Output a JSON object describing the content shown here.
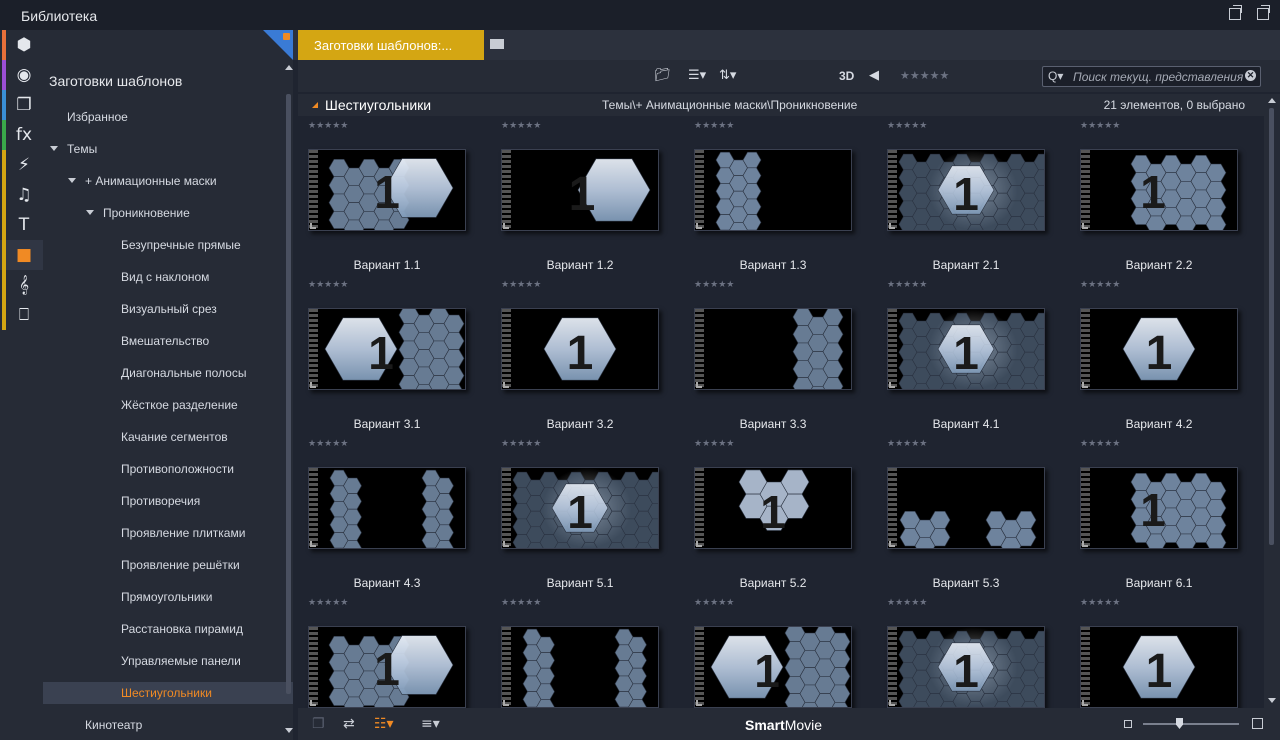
{
  "window": {
    "title": "Библиотека"
  },
  "sidebar_icons": [
    {
      "name": "media-icon",
      "glyph": "⬢",
      "color": "#e8703a"
    },
    {
      "name": "reel-icon",
      "glyph": "◉",
      "color": "#9b4fd6"
    },
    {
      "name": "pages-icon",
      "glyph": "❐",
      "color": "#3a8fd6"
    },
    {
      "name": "fx-icon",
      "glyph": "fx",
      "color": "#3aa84a"
    },
    {
      "name": "lightning-icon",
      "glyph": "⚡",
      "color": "#d4a613"
    },
    {
      "name": "music-icon",
      "glyph": "♫",
      "color": "#d4a613"
    },
    {
      "name": "title-icon",
      "glyph": "T",
      "color": "#d4a613"
    },
    {
      "name": "montage-icon",
      "glyph": "■",
      "color": "#d4a613"
    },
    {
      "name": "clef-icon",
      "glyph": "𝄞",
      "color": "#d4a613"
    },
    {
      "name": "piano-icon",
      "glyph": "⎕",
      "color": "#d4a613"
    }
  ],
  "tree": {
    "heading": "Заготовки шаблонов",
    "items": [
      {
        "label": "Избранное",
        "level": 0,
        "expanded": false
      },
      {
        "label": "Темы",
        "level": 0,
        "expanded": true
      },
      {
        "label": "+ Анимационные маски",
        "level": 1,
        "expanded": true
      },
      {
        "label": "Проникновение",
        "level": 2,
        "expanded": true
      },
      {
        "label": "Безупречные прямые",
        "level": 3
      },
      {
        "label": "Вид с наклоном",
        "level": 3
      },
      {
        "label": "Визуальный срез",
        "level": 3
      },
      {
        "label": "Вмешательство",
        "level": 3
      },
      {
        "label": "Диагональные полосы",
        "level": 3
      },
      {
        "label": "Жёсткое разделение",
        "level": 3
      },
      {
        "label": "Качание сегментов",
        "level": 3
      },
      {
        "label": "Противоположности",
        "level": 3
      },
      {
        "label": "Противоречия",
        "level": 3
      },
      {
        "label": "Проявление плитками",
        "level": 3
      },
      {
        "label": "Проявление решётки",
        "level": 3
      },
      {
        "label": "Прямоугольники",
        "level": 3
      },
      {
        "label": "Расстановка пирамид",
        "level": 3
      },
      {
        "label": "Управляемые панели",
        "level": 3
      },
      {
        "label": "Шестиугольники",
        "level": 3,
        "selected": true
      },
      {
        "label": "Кинотеатр",
        "level": 1
      }
    ]
  },
  "tab": {
    "label": "Заготовки шаблонов:..."
  },
  "toolbar": {
    "three_d": "3D",
    "stars": "★★★★★",
    "search_placeholder": "Поиск текущ. представления"
  },
  "group": {
    "name": "Шестиугольники",
    "path": "Темы\\+ Анимационные маски\\Проникновение",
    "count": "21 элементов, 0 выбрано"
  },
  "items": [
    {
      "label": "Вариант 1.1",
      "variant": "a"
    },
    {
      "label": "Вариант 1.2",
      "variant": "b"
    },
    {
      "label": "Вариант 1.3",
      "variant": "c"
    },
    {
      "label": "Вариант 2.1",
      "variant": "d"
    },
    {
      "label": "Вариант 2.2",
      "variant": "e"
    },
    {
      "label": "Вариант 3.1",
      "variant": "f"
    },
    {
      "label": "Вариант 3.2",
      "variant": "g"
    },
    {
      "label": "Вариант 3.3",
      "variant": "h"
    },
    {
      "label": "Вариант 4.1",
      "variant": "d"
    },
    {
      "label": "Вариант 4.2",
      "variant": "g"
    },
    {
      "label": "Вариант 4.3",
      "variant": "i"
    },
    {
      "label": "Вариант 5.1",
      "variant": "d"
    },
    {
      "label": "Вариант 5.2",
      "variant": "j"
    },
    {
      "label": "Вариант 5.3",
      "variant": "k"
    },
    {
      "label": "Вариант 6.1",
      "variant": "e"
    },
    {
      "label": "",
      "variant": "a"
    },
    {
      "label": "",
      "variant": "i"
    },
    {
      "label": "",
      "variant": "f"
    },
    {
      "label": "",
      "variant": "d"
    },
    {
      "label": "",
      "variant": "g"
    }
  ],
  "item_stars": "★★★★★",
  "bottom": {
    "brand_bold": "Smart",
    "brand_rest": "Movie"
  }
}
